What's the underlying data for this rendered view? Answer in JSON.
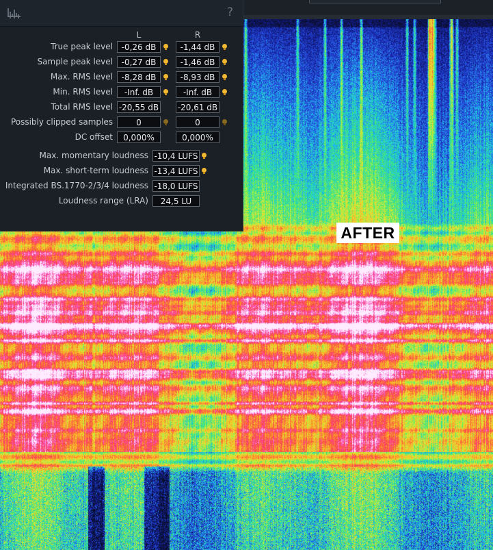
{
  "header": {
    "help_label": "?"
  },
  "columns": {
    "left": "L",
    "right": "R"
  },
  "levels": [
    {
      "label": "True peak level",
      "l": "-0,26 dB",
      "r": "-1,44 dB",
      "indicator": "lit"
    },
    {
      "label": "Sample peak level",
      "l": "-0,27 dB",
      "r": "-1,46 dB",
      "indicator": "lit"
    },
    {
      "label": "Max. RMS level",
      "l": "-8,28 dB",
      "r": "-8,93 dB",
      "indicator": "lit"
    },
    {
      "label": "Min. RMS level",
      "l": "-Inf. dB",
      "r": "-Inf. dB",
      "indicator": "lit"
    },
    {
      "label": "Total RMS level",
      "l": "-20,55 dB",
      "r": "-20,61 dB",
      "indicator": "none"
    },
    {
      "label": "Possibly clipped samples",
      "l": "0",
      "r": "0",
      "indicator": "dim"
    },
    {
      "label": "DC offset",
      "l": "0,000%",
      "r": "0,000%",
      "indicator": "none"
    }
  ],
  "loudness": [
    {
      "label": "Max. momentary loudness",
      "value": "-10,4 LUFS",
      "indicator": "lit"
    },
    {
      "label": "Max. short-term loudness",
      "value": "-13,4 LUFS",
      "indicator": "lit"
    },
    {
      "label": "Integrated BS.1770-2/3/4 loudness",
      "value": "-18,0 LUFS",
      "indicator": "none"
    },
    {
      "label": "Loudness range (LRA)",
      "value": "24,5 LU",
      "indicator": "none"
    }
  ],
  "overlay": {
    "label": "AFTER"
  },
  "colors": {
    "panel_bg": "#1b2026",
    "indicator_lit": "#f2b731",
    "indicator_dim": "#8a6a21"
  },
  "icons": [
    "meter-icon",
    "help-icon",
    "clip-indicator-icon"
  ]
}
